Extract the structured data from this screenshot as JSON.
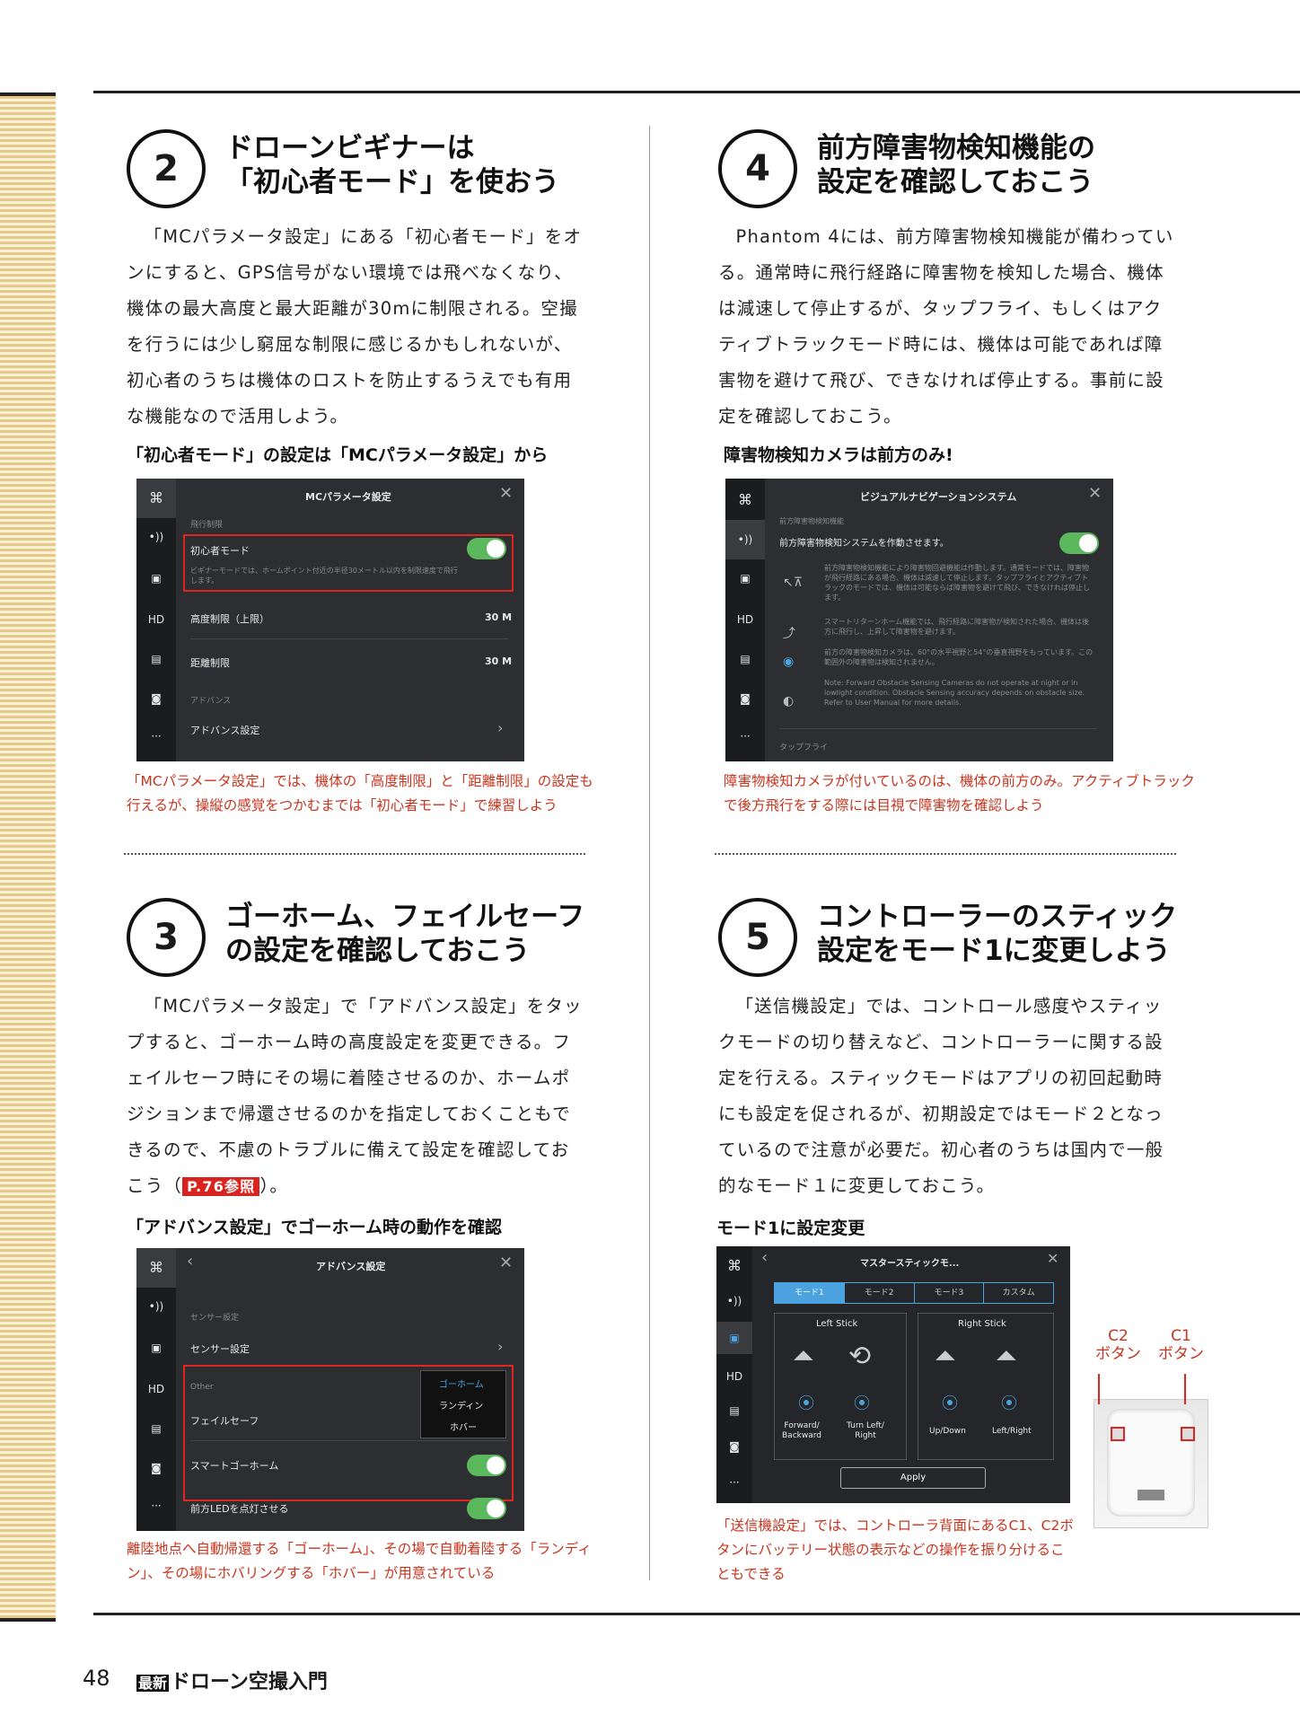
{
  "s2": {
    "num": "2",
    "title1": "ドローンビギナーは",
    "title2": "「初心者モード」を使おう",
    "body": "「MCパラメータ設定」にある「初心者モード」をオンにすると、GPS信号がない環境では飛べなくなり、機体の最大高度と最大距離が30mに制限される。空撮を行うには少し窮屈な制限に感じるかもしれないが、初心者のうちは機体のロストを防止するうえでも有用な機能なので活用しよう。",
    "sub": "「初心者モード」の設定は「MCパラメータ設定」から",
    "cap": "「MCパラメータ設定」では、機体の「高度制限」と「距離制限」の設定も行えるが、操縦の感覚をつかむまでは「初心者モード」で練習しよう",
    "shot": {
      "header": "MCパラメータ設定",
      "section1": "飛行制限",
      "beginner": "初心者モード",
      "beginner_desc": "ビギナーモードでは、ホームポイント付近の半径30メートル以内を制限速度で飛行します。",
      "alt": "高度制限（上限）",
      "alt_val": "30 M",
      "dist": "距離制限",
      "dist_val": "30 M",
      "section2": "アドバンス",
      "adv": "アドバンス設定"
    }
  },
  "s4": {
    "num": "4",
    "title1": "前方障害物検知機能の",
    "title2": "設定を確認しておこう",
    "body": "Phantom 4には、前方障害物検知機能が備わっている。通常時に飛行経路に障害物を検知した場合、機体は減速して停止するが、タップフライ、もしくはアクティブトラックモード時には、機体は可能であれば障害物を避けて飛び、できなければ停止する。事前に設定を確認しておこう。",
    "sub": "障害物検知カメラは前方のみ!",
    "cap": "障害物検知カメラが付いているのは、機体の前方のみ。アクティブトラックで後方飛行をする際には目視で障害物を確認しよう",
    "shot": {
      "header": "ビジュアルナビゲーションシステム",
      "section1": "前方障害物検知機能",
      "enable": "前方障害物検知システムを作動させます。",
      "d1": "前方障害物検知機能により障害物回避機能は作動します。通常モードでは、障害物が飛行経路にある場合、機体は減速して停止します。タップフライとアクティブトラックのモードでは、機体は可能ならば障害物を避けて飛び、できなければ停止します。",
      "d2": "スマートリターンホーム機能では、飛行経路に障害物が検知された場合、機体は後方に飛行し、上昇して障害物を避けます。",
      "d3": "前方の障害物検知カメラは、60°の水平視野と54°の垂直視野をもっています。この範囲外の障害物は検知されません。",
      "d4": "Note: Forward Obstacle Sensing Cameras do not operate at night or in lowlight condition. Obstacle Sensing accuracy depends on obstacle size. Refer to User Manual for more details.",
      "tapfly": "タップフライ"
    }
  },
  "s3": {
    "num": "3",
    "title1": "ゴーホーム、フェイルセーフ",
    "title2": "の設定を確認しておこう",
    "body": "「MCパラメータ設定」で「アドバンス設定」をタップすると、ゴーホーム時の高度設定を変更できる。フェイルセーフ時にその場に着陸させるのか、ホームポジションまで帰還させるのかを指定しておくこともできるので、不慮のトラブルに備えて設定を確認しておこう（",
    "ref": "P.76参照",
    "body_end": "）。",
    "sub": "「アドバンス設定」でゴーホーム時の動作を確認",
    "cap": "離陸地点へ自動帰還する「ゴーホーム」、その場で自動着陸する「ランディン」、その場にホバリングする「ホバー」が用意されている",
    "shot": {
      "header": "アドバンス設定",
      "section1": "センサー設定",
      "sensor": "センサー設定",
      "other": "Other",
      "failsafe": "フェイルセーフ",
      "opt1": "ゴーホーム",
      "opt2": "ランディン",
      "opt3": "ホバー",
      "smart": "スマートゴーホーム",
      "led": "前方LEDを点灯させる"
    }
  },
  "s5": {
    "num": "5",
    "title1": "コントローラーのスティック",
    "title2": "設定をモード1に変更しよう",
    "body": "「送信機設定」では、コントロール感度やスティックモードの切り替えなど、コントローラーに関する設定を行える。スティックモードはアプリの初回起動時にも設定を促されるが、初期設定ではモード２となっているので注意が必要だ。初心者のうちは国内で一般的なモード１に変更しておこう。",
    "sub": "モード1に設定変更",
    "cap": "「送信機設定」では、コントローラ背面にあるC1、C2ボタンにバッテリー状態の表示などの操作を振り分けることもできる",
    "shot": {
      "header": "マスタースティックモ...",
      "tabs": [
        "モード1",
        "モード2",
        "モード3",
        "カスタム"
      ],
      "left": "Left Stick",
      "right": "Right Stick",
      "l1": "Forward/\nBackward",
      "l2": "Turn Left/\nRight",
      "r1": "Up/Down",
      "r2": "Left/Right",
      "apply": "Apply"
    },
    "c2": "C2\nボタン",
    "c1": "C1\nボタン"
  },
  "rail": [
    "HD"
  ],
  "footer": {
    "page": "48",
    "brand_tag": "最新",
    "brand": "ドローン空撮入門"
  }
}
